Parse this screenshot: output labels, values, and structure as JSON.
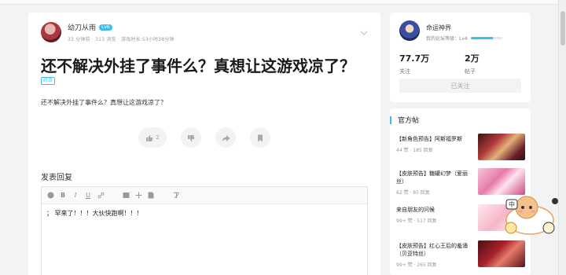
{
  "post": {
    "author": "幼刀从雨",
    "level_badge": "Lv6",
    "meta": "33 分钟前 · 313 浏览 · 游戏时长 53小时38分钟",
    "title": "还不解决外挂了事件么？真想让这游戏凉了？",
    "tag": "综合",
    "body": "还不解决外挂了事件么？真想让这游戏凉了？",
    "like_count": "2"
  },
  "reply": {
    "title": "发表回复",
    "content": "； 罕来了！！！大伙快跑啊！！！"
  },
  "game_card": {
    "name": "命运神界",
    "level_text": "我的论坛等级：Lv4",
    "level_progress": 0.7,
    "followers_value": "77.7万",
    "followers_label": "关注",
    "posts_value": "2万",
    "posts_label": "帖子",
    "follow_button": "已关注"
  },
  "official": {
    "heading": "官方帖",
    "items": [
      {
        "title": "【新角色预告】阿斯福罗斯",
        "meta": "44 赞 · 185 回复"
      },
      {
        "title": "【皮肤预告】糖罐幻梦（爱丽丝）",
        "meta": "62 赞 · 85 回复"
      },
      {
        "title": "来自朋友的问候",
        "meta": "99+ 赞 · 517 回复"
      },
      {
        "title": "【皮肤预告】红心王后的羞涌（贝亚特丝）",
        "meta": "99+ 赞 · 265 回复"
      }
    ]
  },
  "colors": {
    "accent": "#3fbce9"
  }
}
